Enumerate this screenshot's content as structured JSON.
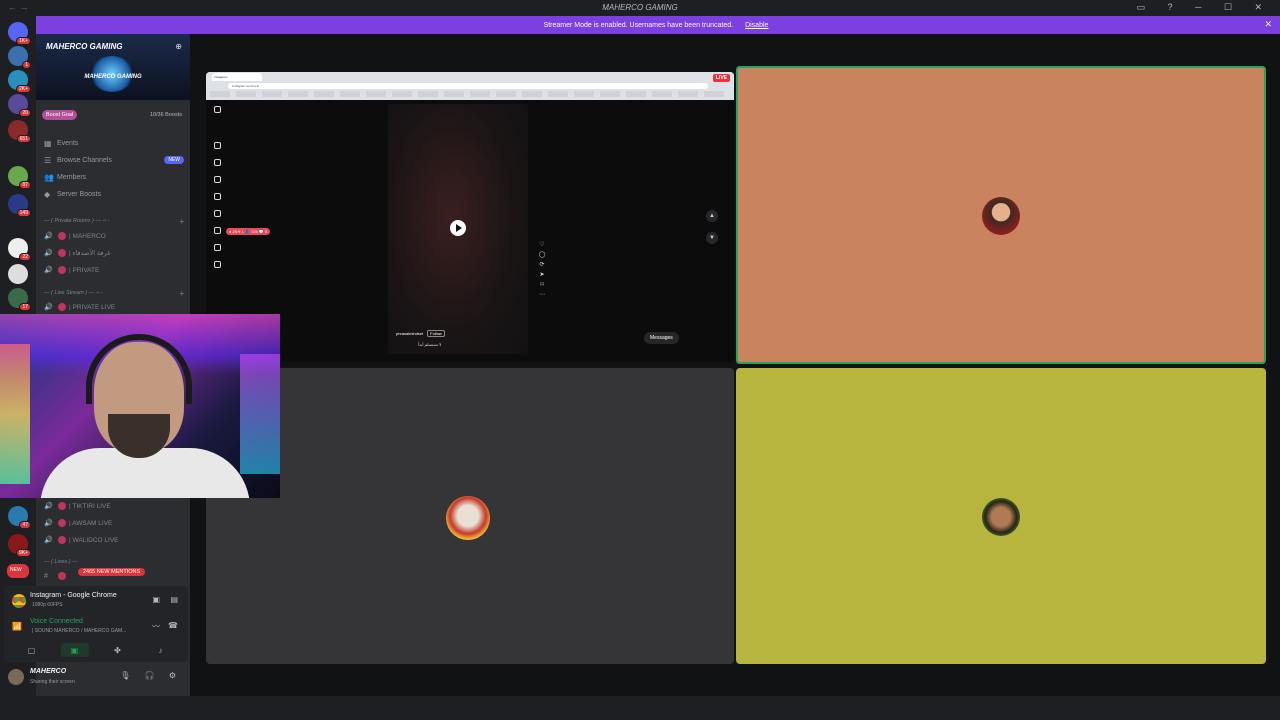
{
  "window": {
    "title": "MAHERCO GAMING",
    "nav": "← →",
    "controls": "▭ ? ─ ☐ ✕"
  },
  "banner": {
    "text": "Streamer Mode is enabled. Usernames have been truncated.",
    "action": "Disable",
    "close": "✕"
  },
  "rail": {
    "servers": [
      {
        "badge": "1K+"
      },
      {
        "badge": "1"
      },
      {
        "badge": "2K+"
      },
      {
        "badge": "20"
      },
      {
        "badge": "651"
      },
      {
        "badge": "87"
      },
      {
        "badge": "149"
      },
      {
        "badge": "22"
      },
      {
        "badge": ""
      },
      {
        "badge": "17"
      },
      {
        "badge": "47"
      },
      {
        "badge": "9K+"
      },
      {
        "badge": "NEW"
      }
    ]
  },
  "sidebar": {
    "server_name": "MAHERCO GAMING",
    "server_logo_text": "MAHERCO GAMING",
    "boost_goal": "Boost Goal",
    "boost_count": "10/36 Boosts",
    "items": [
      {
        "icon": "▦",
        "label": "Events",
        "badge": ""
      },
      {
        "icon": "☰",
        "label": "Browse Channels",
        "badge": "NEW"
      },
      {
        "icon": "👥",
        "label": "Members",
        "badge": ""
      },
      {
        "icon": "◆",
        "label": "Server Boosts",
        "badge": ""
      }
    ],
    "categories": [
      {
        "label": "— ( Private Rooms ) — -‹ -"
      },
      {
        "label": "— ( Live Stream ) — -‹ -"
      },
      {
        "label": "— ( Lives ) —"
      }
    ],
    "channels_private": [
      {
        "label": "| MAHERCO"
      },
      {
        "label": "| غرفة الأصدقاء"
      },
      {
        "label": "| PRIVATE"
      }
    ],
    "channels_stream": [
      {
        "label": "| PRIVATE LIVE"
      }
    ],
    "channels_lives": [
      {
        "label": "| TIKTIRI LIVE"
      },
      {
        "label": "| AWSAM LIVE"
      },
      {
        "label": "| WALIDCO LIVE"
      }
    ],
    "mentions": "2465 NEW MENTIONS"
  },
  "activity": {
    "app_title": "Instagram - Google Chrome",
    "app_sub": "1080p 60FPS",
    "voice_status": "Voice Connected",
    "voice_channel": "| SOUND MAHERCO / MAHERCO GAM...",
    "user_name": "MAHERCO",
    "user_status": "Sharing their screen"
  },
  "stream": {
    "live": "LIVE",
    "tab_title": "Instagram",
    "url": "instagram.com/reels",
    "reel_user": "phrasalmindset",
    "follow": "Follow",
    "caption": "لا تستسلم أبداً",
    "notification": "● 25 ♥ 1 👤 106 💬 5",
    "messages": "Messages"
  },
  "colors": {
    "accent": "#7c3fe0",
    "tile_orange": "#c9845f",
    "tile_gray": "#353538",
    "tile_yellow": "#b8b53f",
    "speaking": "#23a55a"
  }
}
